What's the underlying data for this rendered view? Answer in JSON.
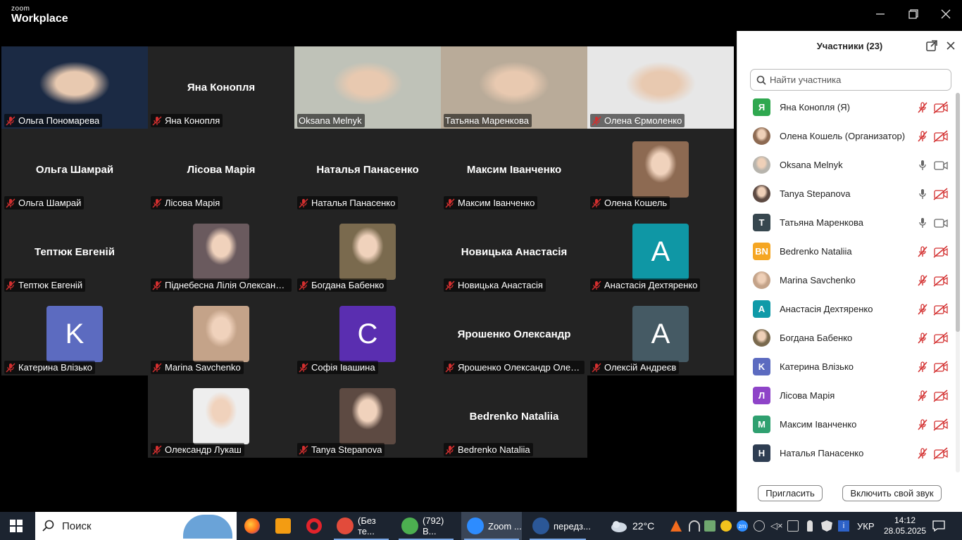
{
  "titlebar": {
    "brand_small": "zoom",
    "brand_big": "Workplace"
  },
  "gallery": {
    "tiles": [
      {
        "label": "Ольга Пономарева",
        "kind": "video",
        "bg": "#1b2a44"
      },
      {
        "label": "Яна Конопля",
        "kind": "name",
        "center": "Яна Конопля"
      },
      {
        "label": "Oksana Melnyk",
        "kind": "video",
        "bg": "#bfc2b8",
        "active": true
      },
      {
        "label": "Татьяна Маренкова",
        "kind": "video",
        "bg": "#b9ab99"
      },
      {
        "label": "Олена Єрмоленко",
        "kind": "video",
        "bg": "#e7e7e7"
      },
      {
        "label": "Ольга Шамрай",
        "kind": "name",
        "center": "Ольга Шамрай"
      },
      {
        "label": "Лісова Марія",
        "kind": "name",
        "center": "Лісова Марія"
      },
      {
        "label": "Наталья Панасенко",
        "kind": "name",
        "center": "Наталья  Панасенко"
      },
      {
        "label": "Максим Іванченко",
        "kind": "name",
        "center": "Максим Іванченко"
      },
      {
        "label": "Олена Кошель",
        "kind": "photo",
        "bg": "#8d6a52"
      },
      {
        "label": "Тептюк Евгеній",
        "kind": "name",
        "center": "Тептюк Евгеній"
      },
      {
        "label": "Піднебесна Лілія Олександрівна",
        "kind": "photo",
        "bg": "#6a5a5e"
      },
      {
        "label": "Богдана Бабенко",
        "kind": "photo",
        "bg": "#7a6a4e"
      },
      {
        "label": "Новицька Анастасія",
        "kind": "name",
        "center": "Новицька  Анастасія"
      },
      {
        "label": "Анастасія Дехтяренко",
        "kind": "letter",
        "letter": "A",
        "color": "#0f97a5"
      },
      {
        "label": "Катерина Влізько",
        "kind": "letter",
        "letter": "K",
        "color": "#5c6bc0"
      },
      {
        "label": "Marina Savchenko",
        "kind": "photo",
        "bg": "#c4a389"
      },
      {
        "label": "Софія Івашина",
        "kind": "letter",
        "letter": "C",
        "color": "#5a2eb0"
      },
      {
        "label": "Ярошенко Олександр Олегович",
        "kind": "name",
        "center": "Ярошенко  Олександр"
      },
      {
        "label": "Олексій Андреєв",
        "kind": "letter",
        "letter": "A",
        "color": "#455a64"
      },
      {
        "label": "Олександр Лукаш",
        "kind": "photo",
        "bg": "#eeeeee"
      },
      {
        "label": "Tanya Stepanova",
        "kind": "photo",
        "bg": "#5d4a42"
      },
      {
        "label": "Bedrenko Nataliia",
        "kind": "name",
        "center": "Bedrenko Nataliia"
      }
    ]
  },
  "panel": {
    "title": "Участники (23)",
    "search_placeholder": "Найти участника",
    "participants": [
      {
        "name": "Яна Конопля (Я)",
        "avatar": "Я",
        "color": "#2fa84f",
        "audio": "muted",
        "video": "off"
      },
      {
        "name": "Олена Кошель (Организатор)",
        "avatar": "",
        "color": "#8d6a52",
        "audio": "muted",
        "video": "off"
      },
      {
        "name": "Oksana Melnyk",
        "avatar": "",
        "color": "#b7b4ad",
        "audio": "on",
        "video": "on"
      },
      {
        "name": "Tanya Stepanova",
        "avatar": "",
        "color": "#5d4a42",
        "audio": "on",
        "video": "off"
      },
      {
        "name": "Татьяна Маренкова",
        "avatar": "T",
        "color": "#37474f",
        "audio": "on",
        "video": "on"
      },
      {
        "name": "Bedrenko Nataliia",
        "avatar": "BN",
        "color": "#f5a623",
        "audio": "muted",
        "video": "off"
      },
      {
        "name": "Marina Savchenko",
        "avatar": "",
        "color": "#c4a389",
        "audio": "muted",
        "video": "off"
      },
      {
        "name": "Анастасія Дехтяренко",
        "avatar": "A",
        "color": "#0f9aa8",
        "audio": "muted",
        "video": "off"
      },
      {
        "name": "Богдана Бабенко",
        "avatar": "",
        "color": "#7a6a4e",
        "audio": "muted",
        "video": "off"
      },
      {
        "name": "Катерина Влізько",
        "avatar": "K",
        "color": "#5c6bc0",
        "audio": "muted",
        "video": "off"
      },
      {
        "name": "Лісова Марія",
        "avatar": "Л",
        "color": "#8e44c8",
        "audio": "muted",
        "video": "off"
      },
      {
        "name": "Максим Іванченко",
        "avatar": "M",
        "color": "#2fa070",
        "audio": "muted",
        "video": "off"
      },
      {
        "name": "Наталья Панасенко",
        "avatar": "H",
        "color": "#2e3d52",
        "audio": "muted",
        "video": "off"
      }
    ],
    "invite_label": "Пригласить",
    "unmute_label": "Включить свой звук"
  },
  "taskbar": {
    "search_label": "Поиск",
    "apps": [
      {
        "label": "(Без те...",
        "color": "#e24b3b"
      },
      {
        "label": "(792) В...",
        "color": "#4caf50"
      },
      {
        "label": "Zoom ...",
        "color": "#2d8cff"
      },
      {
        "label": "передз...",
        "color": "#2b5797"
      }
    ],
    "weather": "22°C",
    "language": "УКР",
    "time": "14:12",
    "date": "28.05.2025"
  },
  "colors": {
    "active_speaker": "#23d96b",
    "muted_red": "#d32f2f",
    "taskbar": "#1c2430"
  }
}
